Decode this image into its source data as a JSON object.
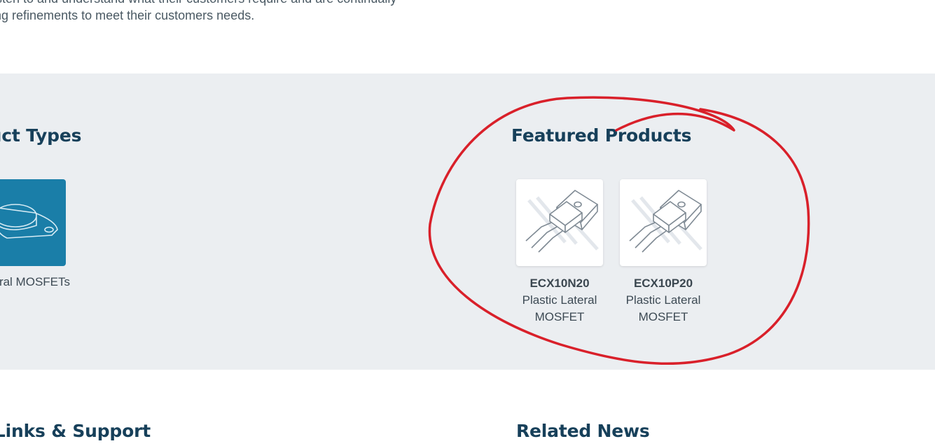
{
  "intro": {
    "line1": "ON listen to and understand what their customers require and are continually",
    "line2": "eloping refinements to meet their customers needs."
  },
  "product_types": {
    "heading": "oduct Types",
    "items": [
      {
        "label": "ral MOSFETs",
        "icon": "to3-package-icon"
      }
    ]
  },
  "featured_products": {
    "heading": "Featured Products",
    "items": [
      {
        "code": "ECX10N20",
        "description": "Plastic Lateral MOSFET",
        "icon": "to247-transistor-icon"
      },
      {
        "code": "ECX10P20",
        "description": "Plastic Lateral MOSFET",
        "icon": "to247-transistor-icon"
      }
    ]
  },
  "useful_links": {
    "heading": "eful Links & Support"
  },
  "related_news": {
    "heading": "Related News"
  },
  "colors": {
    "heading": "#17405a",
    "band": "#ebeef1",
    "tile": "#1a7ea8",
    "annotation": "#d9202a"
  }
}
